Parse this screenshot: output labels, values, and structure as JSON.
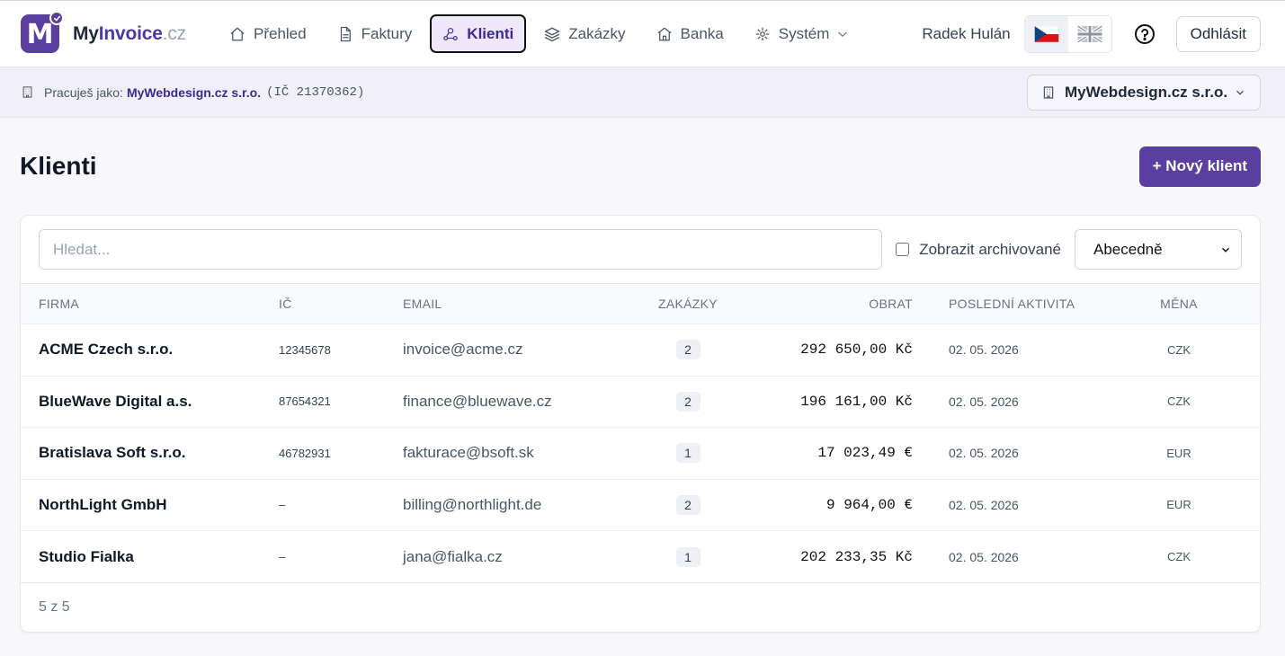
{
  "brand": {
    "part1": "My",
    "part2": "Invoice",
    "part3": ".cz",
    "logo_letter": "M"
  },
  "nav": {
    "items": [
      {
        "label": "Přehled"
      },
      {
        "label": "Faktury"
      },
      {
        "label": "Klienti"
      },
      {
        "label": "Zakázky"
      },
      {
        "label": "Banka"
      },
      {
        "label": "Systém"
      }
    ]
  },
  "user": {
    "name": "Radek Hulán",
    "logout_label": "Odhlásit"
  },
  "context": {
    "prefix": "Pracuješ jako:",
    "company": "MyWebdesign.cz s.r.o.",
    "ic": "(IČ 21370362)",
    "selector_value": "MyWebdesign.cz s.r.o."
  },
  "page": {
    "title": "Klienti",
    "new_button": "+ Nový klient"
  },
  "filters": {
    "search_placeholder": "Hledat...",
    "archived_label": "Zobrazit archivované",
    "sort_value": "Abecedně"
  },
  "table": {
    "headers": {
      "firma": "FIRMA",
      "ic": "IČ",
      "email": "EMAIL",
      "zakazky": "ZAKÁZKY",
      "obrat": "OBRAT",
      "aktivita": "POSLEDNÍ AKTIVITA",
      "mena": "MĚNA"
    },
    "rows": [
      {
        "firma": "ACME Czech s.r.o.",
        "ic": "12345678",
        "email": "invoice@acme.cz",
        "zakazky": "2",
        "obrat": "292 650,00 Kč",
        "aktivita": "02. 05. 2026",
        "mena": "CZK"
      },
      {
        "firma": "BlueWave Digital a.s.",
        "ic": "87654321",
        "email": "finance@bluewave.cz",
        "zakazky": "2",
        "obrat": "196 161,00 Kč",
        "aktivita": "02. 05. 2026",
        "mena": "CZK"
      },
      {
        "firma": "Bratislava Soft s.r.o.",
        "ic": "46782931",
        "email": "fakturace@bsoft.sk",
        "zakazky": "1",
        "obrat": "17 023,49 €",
        "aktivita": "02. 05. 2026",
        "mena": "EUR"
      },
      {
        "firma": "NorthLight GmbH",
        "ic": "–",
        "email": "billing@northlight.de",
        "zakazky": "2",
        "obrat": "9 964,00 €",
        "aktivita": "02. 05. 2026",
        "mena": "EUR"
      },
      {
        "firma": "Studio Fialka",
        "ic": "–",
        "email": "jana@fialka.cz",
        "zakazky": "1",
        "obrat": "202 233,35 Kč",
        "aktivita": "02. 05. 2026",
        "mena": "CZK"
      }
    ],
    "footer": "5 z 5"
  },
  "colors": {
    "accent": "#5b3fa0",
    "accent_text": "#3d2a95",
    "context_bg": "#f1effa"
  },
  "icons": [
    "home-icon",
    "document-icon",
    "users-icon",
    "layers-icon",
    "bank-icon",
    "gear-icon",
    "chevron-down-icon",
    "cz-flag-icon",
    "uk-flag-icon",
    "help-icon",
    "building-icon"
  ]
}
